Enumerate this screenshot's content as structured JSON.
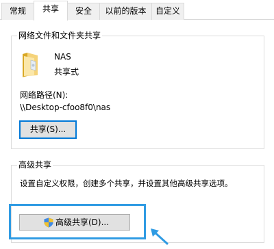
{
  "tabs": [
    {
      "label": "常规",
      "active": false
    },
    {
      "label": "共享",
      "active": true
    },
    {
      "label": "安全",
      "active": false
    },
    {
      "label": "以前的版本",
      "active": false
    },
    {
      "label": "自定义",
      "active": false
    }
  ],
  "network_sharing": {
    "title": "网络文件和文件夹共享",
    "folder_icon": "shared-folder-icon",
    "name": "NAS",
    "status": "共享式",
    "path_label": "网络路径(N):",
    "path_value": "\\\\Desktop-cfoo8f0\\nas",
    "share_button": "共享(S)..."
  },
  "advanced_sharing": {
    "title": "高级共享",
    "description": "设置自定义权限，创建多个共享，并设置其他高级共享选项。",
    "button_icon": "uac-shield-icon",
    "button": "高级共享(D)..."
  },
  "colors": {
    "highlight": "#2f9be3",
    "accent": "#0078d7"
  }
}
